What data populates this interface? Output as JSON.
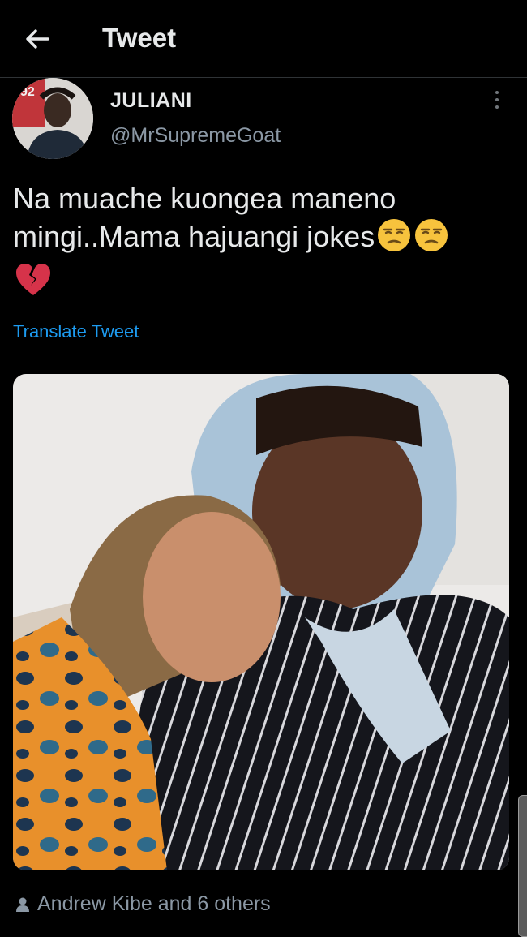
{
  "header": {
    "title": "Tweet",
    "back_icon": "arrow-left-icon"
  },
  "author": {
    "name": "JULIANI",
    "handle": "@MrSupremeGoat",
    "avatar_badge": "92"
  },
  "tweet": {
    "line1": "Na muache kuongea maneno",
    "line2": "mingi..Mama hajuangi jokes",
    "emojis": [
      "unamused-face-icon",
      "unamused-face-icon",
      "broken-heart-icon"
    ],
    "translate_label": "Translate Tweet"
  },
  "photo": {
    "description_icon": "photo-image"
  },
  "engagement": {
    "liked_by": "Andrew Kibe and 6 others",
    "icon": "person-icon"
  },
  "colors": {
    "background": "#000000",
    "text": "#e7e9ea",
    "muted": "#8b98a5",
    "link": "#1d9bf0"
  }
}
